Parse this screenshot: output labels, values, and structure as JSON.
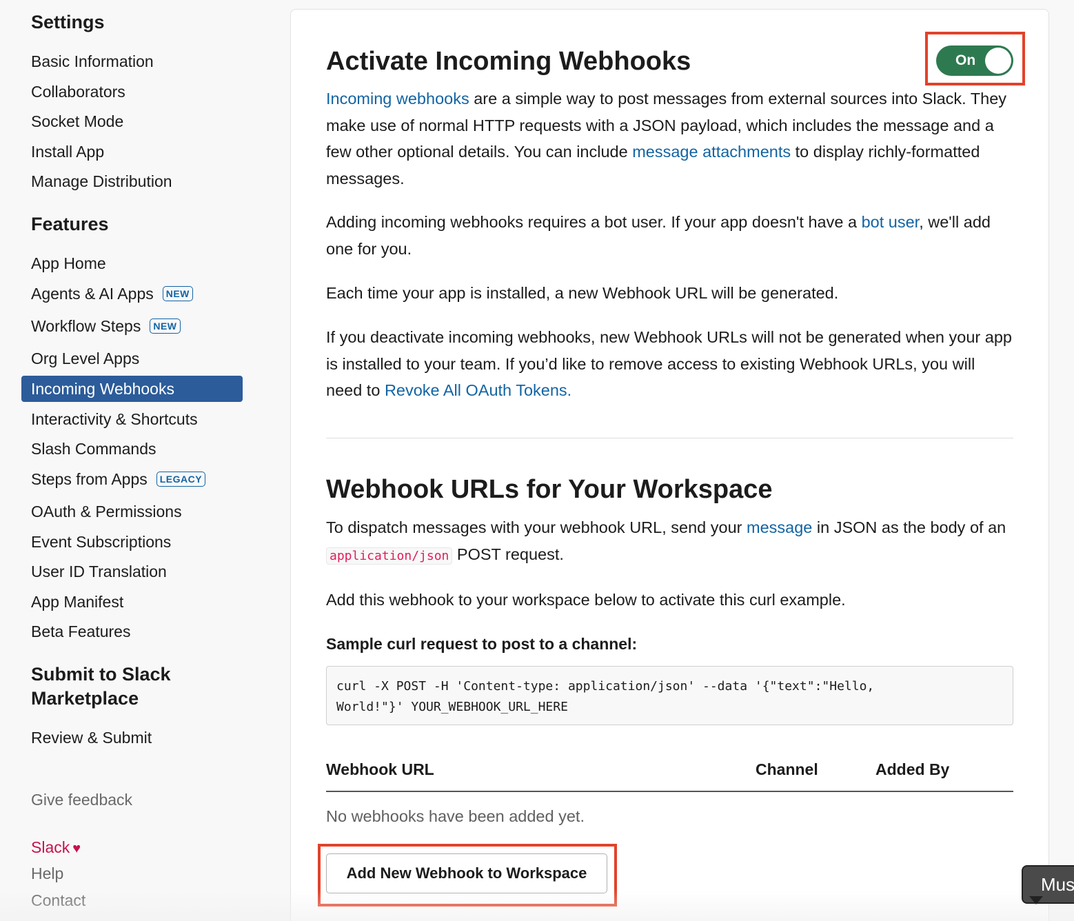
{
  "sidebar": {
    "settings_heading": "Settings",
    "settings_items": [
      "Basic Information",
      "Collaborators",
      "Socket Mode",
      "Install App",
      "Manage Distribution"
    ],
    "features_heading": "Features",
    "features_items": [
      {
        "label": "App Home",
        "badge": ""
      },
      {
        "label": "Agents & AI Apps",
        "badge": "NEW"
      },
      {
        "label": "Workflow Steps",
        "badge": "NEW"
      },
      {
        "label": "Org Level Apps",
        "badge": ""
      },
      {
        "label": "Incoming Webhooks",
        "badge": "",
        "active": true
      },
      {
        "label": "Interactivity & Shortcuts",
        "badge": ""
      },
      {
        "label": "Slash Commands",
        "badge": ""
      },
      {
        "label": "Steps from Apps",
        "badge": "LEGACY"
      },
      {
        "label": "OAuth & Permissions",
        "badge": ""
      },
      {
        "label": "Event Subscriptions",
        "badge": ""
      },
      {
        "label": "User ID Translation",
        "badge": ""
      },
      {
        "label": "App Manifest",
        "badge": ""
      },
      {
        "label": "Beta Features",
        "badge": ""
      }
    ],
    "submit_heading_line1": "Submit to Slack",
    "submit_heading_line2": "Marketplace",
    "submit_items": [
      "Review & Submit"
    ],
    "feedback": "Give feedback",
    "slack_link": "Slack",
    "help": "Help",
    "contact": "Contact"
  },
  "activate": {
    "title": "Activate Incoming Webhooks",
    "toggle_label": "On",
    "toggle_state": "on",
    "p1_link1": "Incoming webhooks",
    "p1_text1": " are a simple way to post messages from external sources into Slack. They make use of normal HTTP requests with a JSON payload, which includes the message and a few other optional details. You can include ",
    "p1_link2": "message attachments",
    "p1_text2": " to display richly-formatted messages.",
    "p2_text1": "Adding incoming webhooks requires a bot user. If your app doesn't have a ",
    "p2_link": "bot user",
    "p2_text2": ", we'll add one for you.",
    "p3": "Each time your app is installed, a new Webhook URL will be generated.",
    "p4_text": "If you deactivate incoming webhooks, new Webhook URLs will not be generated when your app is installed to your team. If you’d like to remove access to existing Webhook URLs, you will need to ",
    "p4_link": "Revoke All OAuth Tokens."
  },
  "workspace": {
    "title": "Webhook URLs for Your Workspace",
    "p1_text1": "To dispatch messages with your webhook URL, send your ",
    "p1_link": "message",
    "p1_text2": " in JSON as the body of an ",
    "p1_code": "application/json",
    "p1_text3": " POST request.",
    "p2": "Add this webhook to your workspace below to activate this curl example.",
    "sample_heading": "Sample curl request to post to a channel:",
    "curl_line1": "curl -X POST -H 'Content-type: application/json' --data '{\"text\":\"Hello,",
    "curl_line2": "World!\"}' YOUR_WEBHOOK_URL_HERE",
    "table_headers": [
      "Webhook URL",
      "Channel",
      "Added By"
    ],
    "empty_text": "No webhooks have been added yet.",
    "add_button": "Add New Webhook to Workspace"
  },
  "popup_text": "Mus",
  "colors": {
    "accent": "#2c5c9a",
    "link": "#1264a3",
    "toggle_on": "#2e7a50",
    "highlight": "#e2422a",
    "code": "#e01e5a"
  }
}
